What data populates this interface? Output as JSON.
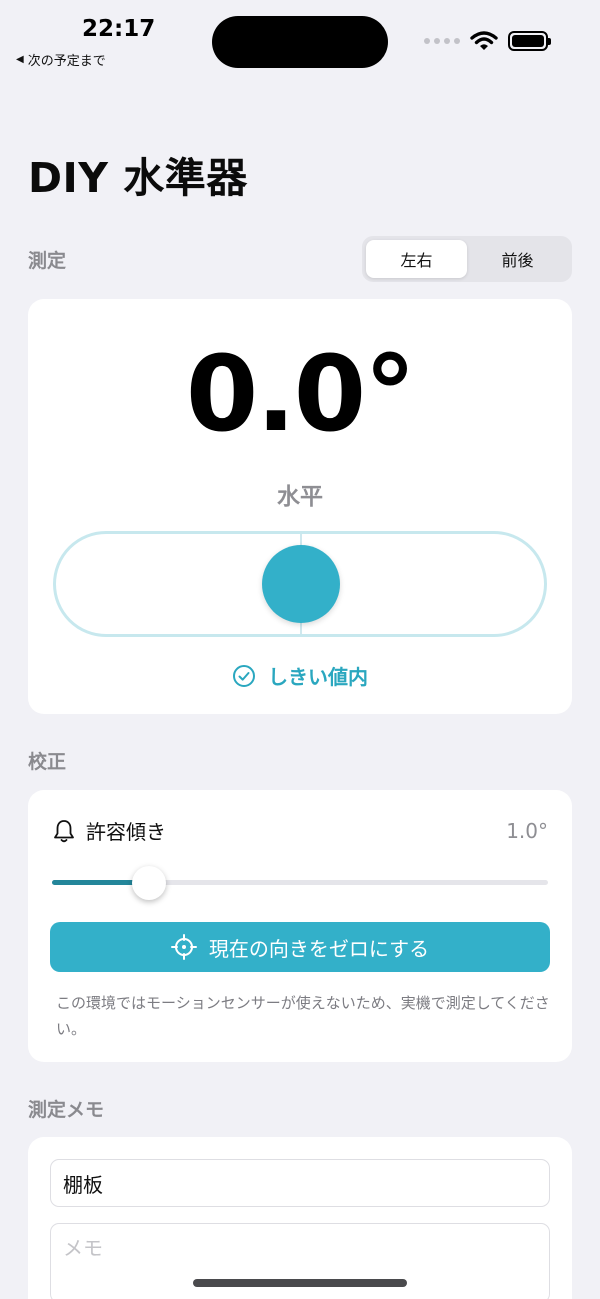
{
  "status_bar": {
    "time": "22:17",
    "back_app_label": "次の予定まで",
    "battery_level": 1.0
  },
  "page": {
    "title": "DIY 水準器"
  },
  "measurement": {
    "section_label": "測定",
    "segments": [
      {
        "label": "左右",
        "selected": true
      },
      {
        "label": "前後",
        "selected": false
      }
    ],
    "angle": "0.0°",
    "state_label": "水平",
    "bubble_offset": 0.0,
    "threshold_label": "しきい値内",
    "accent_color": "#33b0c9"
  },
  "calibration": {
    "section_label": "校正",
    "tolerance_label": "許容傾き",
    "tolerance_value": "1.0°",
    "slider_fraction": 0.195,
    "zero_button_label": "現在の向きをゼロにする",
    "note": "この環境ではモーションセンサーが使えないため、実機で測定してください。"
  },
  "memo": {
    "section_label": "測定メモ",
    "name_value": "棚板",
    "body_placeholder": "メモ"
  },
  "icons": {
    "back": "triangle-left-icon",
    "wifi": "wifi-icon",
    "battery": "battery-icon",
    "check": "check-circle-icon",
    "bell": "bell-icon",
    "target": "crosshair-icon"
  }
}
